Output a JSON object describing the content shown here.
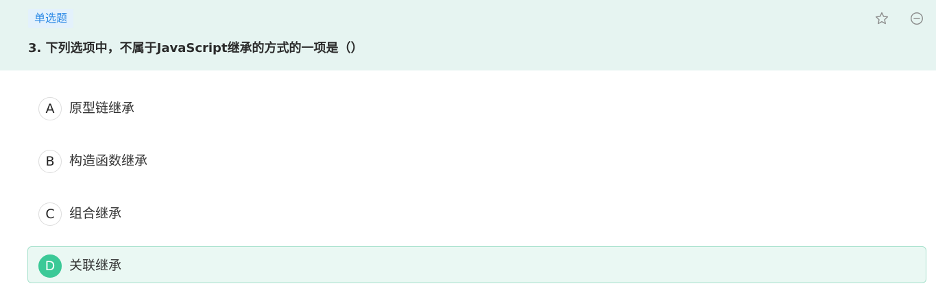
{
  "question": {
    "type_label": "单选题",
    "title": "3. 下列选项中，不属于JavaScript继承的方式的一项是（）"
  },
  "icons": {
    "favorite": "star-icon",
    "remove": "minus-circle-icon"
  },
  "options": [
    {
      "letter": "A",
      "text": "原型链继承",
      "selected": false
    },
    {
      "letter": "B",
      "text": "构造函数继承",
      "selected": false
    },
    {
      "letter": "C",
      "text": "组合继承",
      "selected": false
    },
    {
      "letter": "D",
      "text": "关联继承",
      "selected": true
    }
  ],
  "colors": {
    "header_bg": "#e6f4f1",
    "tag_text": "#2f8be6",
    "selected_accent": "#3bc997",
    "selected_bg": "#eaf8f3"
  }
}
